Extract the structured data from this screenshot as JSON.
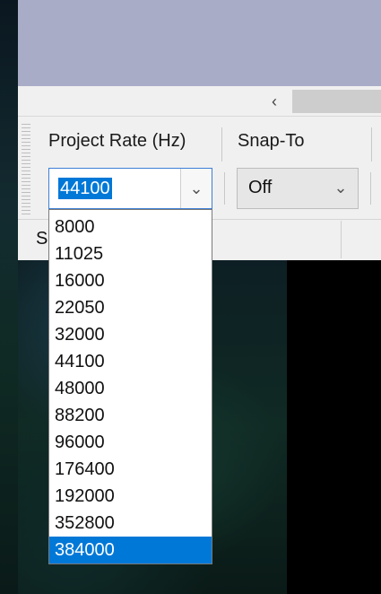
{
  "toolbar": {
    "project_rate_label": "Project Rate (Hz)",
    "snap_to_label": "Snap-To"
  },
  "project_rate": {
    "value": "44100",
    "options": [
      "8000",
      "11025",
      "16000",
      "22050",
      "32000",
      "44100",
      "48000",
      "88200",
      "96000",
      "176400",
      "192000",
      "352800",
      "384000"
    ],
    "highlighted_option": "384000"
  },
  "snap_to": {
    "value": "Off"
  },
  "status": {
    "partial_label": "S"
  },
  "icons": {
    "dropdown_arrow": "chevron-down",
    "scroll_left": "chevron-left"
  }
}
